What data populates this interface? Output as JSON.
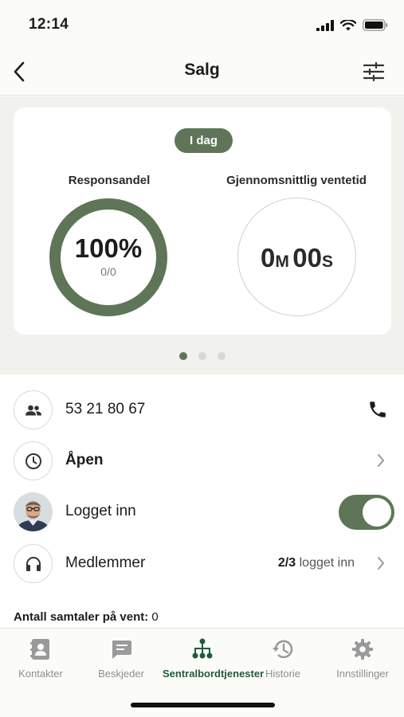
{
  "status_bar": {
    "time": "12:14"
  },
  "nav": {
    "title": "Salg"
  },
  "stats": {
    "period": "I dag",
    "response_rate": {
      "label": "Responsandel",
      "value": "100%",
      "detail": "0/0",
      "fraction": 1.0
    },
    "avg_wait": {
      "label": "Gjennomsnittlig ventetid",
      "minutes": "0",
      "minutes_unit": "M",
      "seconds": "00",
      "seconds_unit": "S"
    },
    "pages": {
      "count": 3,
      "active": 1
    }
  },
  "rows": {
    "phone": {
      "number": "53 21 80 67",
      "icon": "group-icon",
      "action_icon": "phone-icon"
    },
    "hours": {
      "status": "Åpen",
      "icon": "clock-icon"
    },
    "login": {
      "label": "Logget inn",
      "toggle_on": true
    },
    "members": {
      "label": "Medlemmer",
      "count": "2/3",
      "count_suffix": "logget inn",
      "icon": "headset-icon"
    }
  },
  "queue": {
    "label": "Antall samtaler på vent:",
    "value": "0"
  },
  "tabs": [
    {
      "label": "Kontakter",
      "icon": "contacts-icon",
      "active": false
    },
    {
      "label": "Beskjeder",
      "icon": "message-icon",
      "active": false
    },
    {
      "label": "Sentralbordtjenester",
      "icon": "org-chart-icon",
      "active": true
    },
    {
      "label": "Historie",
      "icon": "history-icon",
      "active": false
    },
    {
      "label": "Innstillinger",
      "icon": "gear-icon",
      "active": false
    }
  ],
  "colors": {
    "accent": "#5e7657",
    "active_tab": "#1e5c3b",
    "background": "#f1f1ed"
  }
}
